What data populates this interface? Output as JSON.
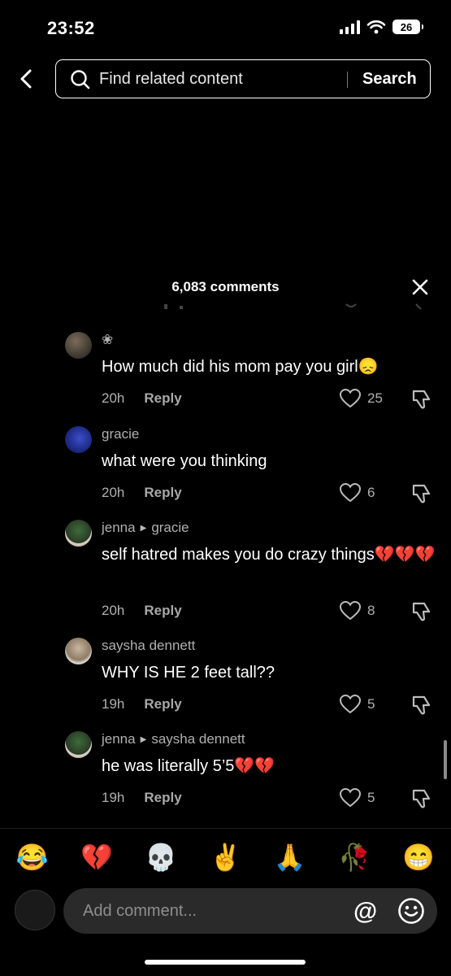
{
  "status_bar": {
    "time": "23:52",
    "battery": "26"
  },
  "search": {
    "placeholder": "Find related content",
    "button_label": "Search"
  },
  "comments_panel": {
    "count_label": "6,083 comments",
    "comments": [
      {
        "user": "❀",
        "reply_to": "",
        "text": "How much did his mom pay you girl😞",
        "age": "20h",
        "reply_label": "Reply",
        "likes": "25"
      },
      {
        "user": "gracie",
        "reply_to": "",
        "text": "what were you thinking",
        "age": "20h",
        "reply_label": "Reply",
        "likes": "6"
      },
      {
        "user": "jenna",
        "reply_to": "gracie",
        "text": "self hatred makes you do crazy things💔💔💔",
        "age": "20h",
        "reply_label": "Reply",
        "likes": "8"
      },
      {
        "user": "saysha dennett",
        "reply_to": "",
        "text": "WHY IS HE 2 feet tall??",
        "age": "19h",
        "reply_label": "Reply",
        "likes": "5"
      },
      {
        "user": "jenna",
        "reply_to": "saysha dennett",
        "text": "he was literally 5’5💔💔",
        "age": "19h",
        "reply_label": "Reply",
        "likes": "5"
      }
    ]
  },
  "emoji_bar": [
    "😂",
    "💔",
    "💀",
    "✌️",
    "🙏",
    "🥀",
    "😁"
  ],
  "composer": {
    "placeholder": "Add comment...",
    "at_symbol": "@"
  },
  "colors": {
    "background": "#000000",
    "text": "#ffffff",
    "muted": "#b0b0b0",
    "input_bg": "#2a2a2a"
  }
}
